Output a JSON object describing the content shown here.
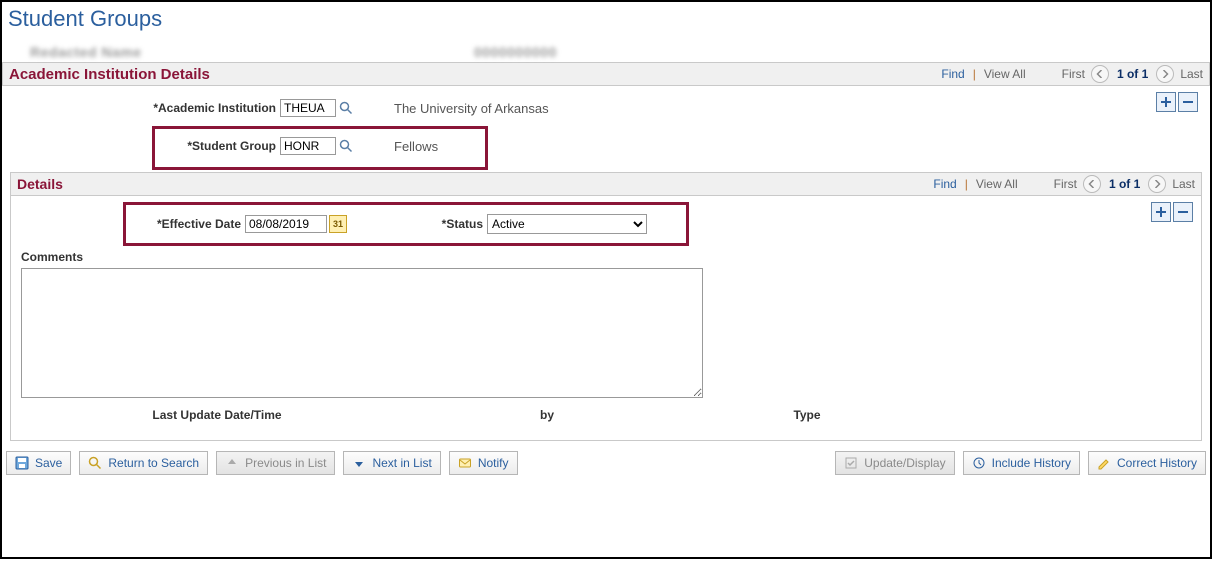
{
  "page": {
    "title": "Student Groups"
  },
  "blurred": {
    "left": "Redacted Name",
    "right": "0000000000"
  },
  "section_aid": {
    "title": "Academic Institution Details",
    "nav": {
      "find": "Find",
      "viewAll": "View All",
      "first": "First",
      "count": "1 of 1",
      "last": "Last"
    },
    "fields": {
      "institution_label": "Academic Institution",
      "institution_value": "THEUA",
      "institution_desc": "The University of Arkansas",
      "group_label": "Student Group",
      "group_value": "HONR",
      "group_desc": "Fellows"
    }
  },
  "section_details": {
    "title": "Details",
    "nav": {
      "find": "Find",
      "viewAll": "View All",
      "first": "First",
      "count": "1 of 1",
      "last": "Last"
    },
    "effdt_label": "Effective Date",
    "effdt_value": "08/08/2019",
    "status_label": "Status",
    "status_value": "Active",
    "comments_label": "Comments",
    "meta": {
      "c1": "Last Update Date/Time",
      "c2": "by",
      "c3": "Type"
    }
  },
  "toolbar": {
    "save": "Save",
    "return": "Return to Search",
    "prev": "Previous in List",
    "next": "Next in List",
    "notify": "Notify",
    "update": "Update/Display",
    "include": "Include History",
    "correct": "Correct History"
  }
}
